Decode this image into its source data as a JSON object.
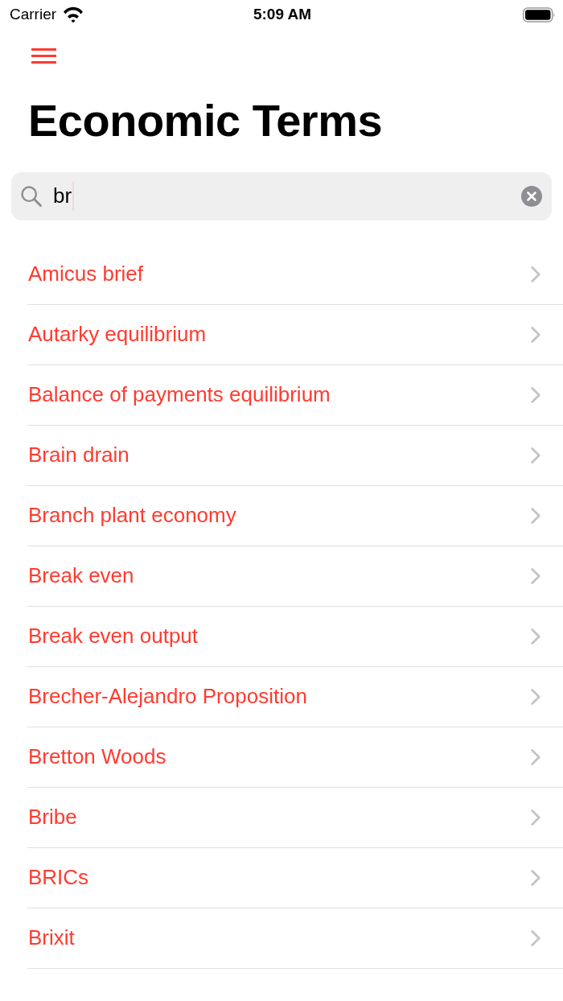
{
  "status_bar": {
    "carrier": "Carrier",
    "time": "5:09 AM"
  },
  "header": {
    "title": "Economic Terms"
  },
  "search": {
    "value": "br"
  },
  "terms": [
    {
      "label": "Amicus brief"
    },
    {
      "label": "Autarky equilibrium"
    },
    {
      "label": "Balance of payments equilibrium"
    },
    {
      "label": "Brain drain"
    },
    {
      "label": "Branch plant economy"
    },
    {
      "label": "Break even"
    },
    {
      "label": "Break even output"
    },
    {
      "label": "Brecher-Alejandro Proposition"
    },
    {
      "label": "Bretton Woods"
    },
    {
      "label": "Bribe"
    },
    {
      "label": "BRICs"
    },
    {
      "label": "Brixit"
    }
  ]
}
